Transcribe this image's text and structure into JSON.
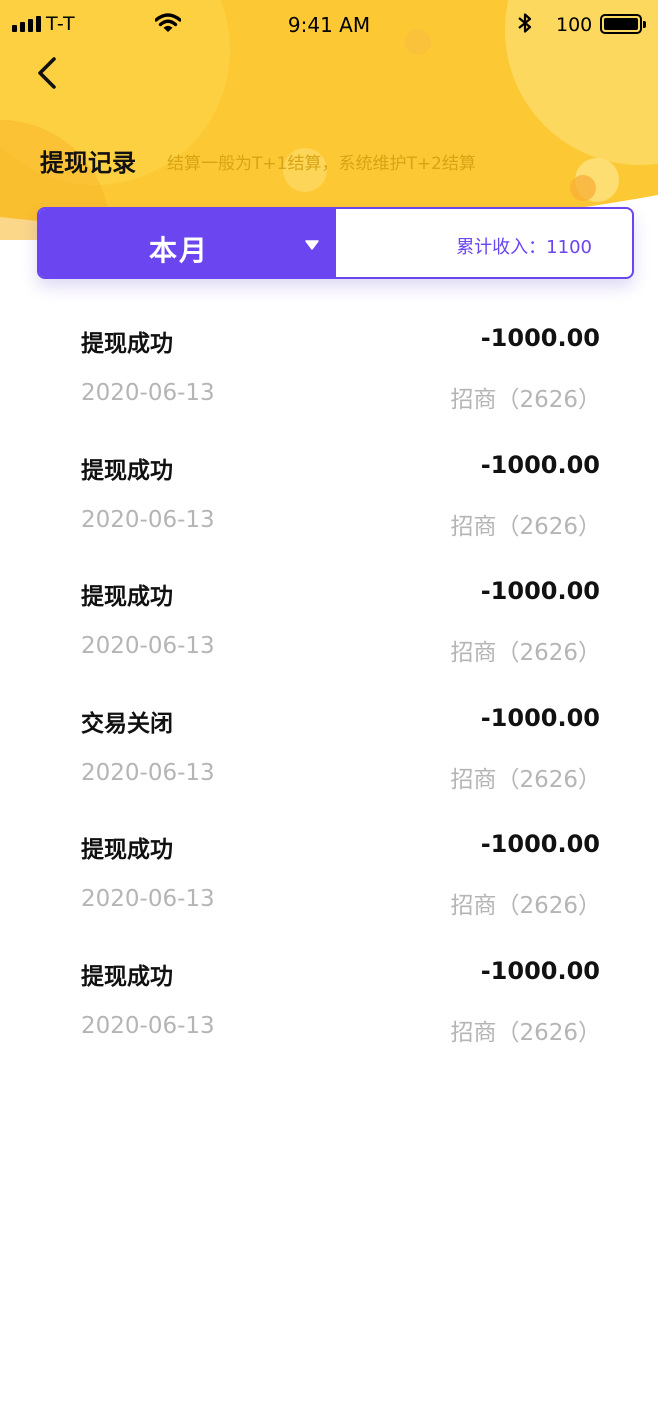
{
  "colors": {
    "header_yellow": "#fcc934",
    "accent_purple": "#6a45f0",
    "muted_text": "#b5b5b5",
    "subtitle_text": "#d8a415"
  },
  "status_bar": {
    "carrier": "T-T",
    "time": "9:41 AM",
    "battery": "100"
  },
  "header": {
    "title": "提现记录",
    "subtitle": "结算一般为T+1结算，系统维护T+2结算"
  },
  "filter": {
    "month_label": "本月",
    "total_income": "累计收入：1100"
  },
  "records": [
    {
      "status": "提现成功",
      "amount": "-1000.00",
      "date": "2020-06-13",
      "bank": "招商（2626）"
    },
    {
      "status": "提现成功",
      "amount": "-1000.00",
      "date": "2020-06-13",
      "bank": "招商（2626）"
    },
    {
      "status": "提现成功",
      "amount": "-1000.00",
      "date": "2020-06-13",
      "bank": "招商（2626）"
    },
    {
      "status": "交易关闭",
      "amount": "-1000.00",
      "date": "2020-06-13",
      "bank": "招商（2626）"
    },
    {
      "status": "提现成功",
      "amount": "-1000.00",
      "date": "2020-06-13",
      "bank": "招商（2626）"
    },
    {
      "status": "提现成功",
      "amount": "-1000.00",
      "date": "2020-06-13",
      "bank": "招商（2626）"
    }
  ]
}
